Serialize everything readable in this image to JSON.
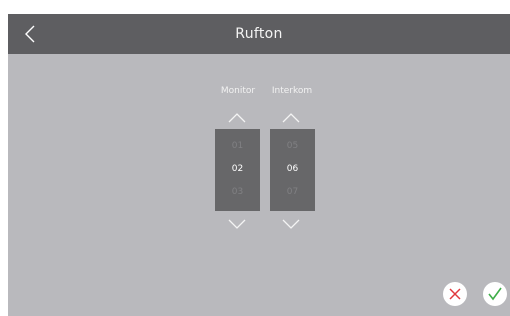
{
  "header": {
    "title": "Rufton",
    "back_icon": "chevron-left-icon"
  },
  "pickers": {
    "monitor": {
      "label": "Monitor",
      "prev": "01",
      "selected": "02",
      "next": "03"
    },
    "interkom": {
      "label": "Interkom",
      "prev": "05",
      "selected": "06",
      "next": "07"
    }
  },
  "actions": {
    "cancel_icon": "x-icon",
    "confirm_icon": "checkmark-icon"
  },
  "colors": {
    "titlebar": "#5e5e61",
    "background": "#b9b9bd",
    "picker": "#676769",
    "cancel": "#e0393e",
    "confirm": "#3fae49"
  }
}
